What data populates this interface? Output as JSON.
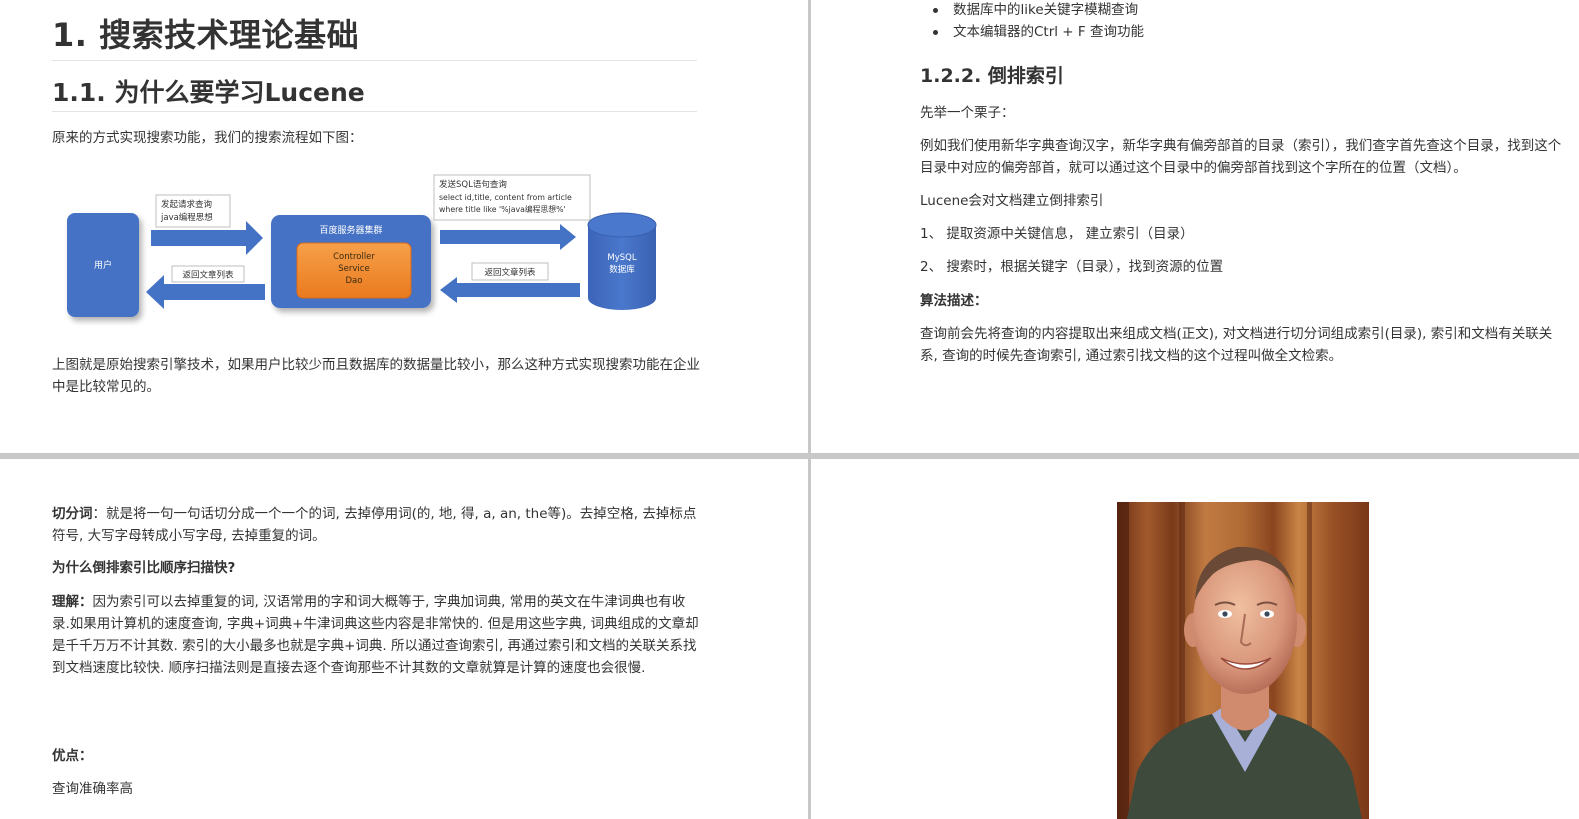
{
  "p1": {
    "h1": "1. 搜索技术理论基础",
    "h2": "1.1. 为什么要学习Lucene",
    "intro": "原来的方式实现搜索功能，我们的搜索流程如下图：",
    "diagram": {
      "user": "用户",
      "req_l1": "发起请求查询",
      "req_l2": "java编程思想",
      "ret1": "返回文章列表",
      "server_title": "百度服务器集群",
      "srv_l1": "Controller",
      "srv_l2": "Service",
      "srv_l3": "Dao",
      "sql_l1": "发送SQL语句查询",
      "sql_l2": "select id,title, content  from  article",
      "sql_l3": "where  title  like  '%java编程思想%'",
      "ret2": "返回文章列表",
      "db_l1": "MySQL",
      "db_l2": "数据库"
    },
    "outro": "上图就是原始搜索引擎技术，如果用户比较少而且数据库的数据量比较小，那么这种方式实现搜索功能在企业中是比较常见的。"
  },
  "p2": {
    "bullets": [
      "数据库中的like关键字模糊查询",
      "文本编辑器的Ctrl + F 查询功能"
    ],
    "h3": "1.2.2. 倒排索引",
    "p1": "先举一个栗子：",
    "p2": "例如我们使用新华字典查询汉字，新华字典有偏旁部首的目录（索引），我们查字首先查这个目录，找到这个目录中对应的偏旁部首，就可以通过这个目录中的偏旁部首找到这个字所在的位置（文档）。",
    "p3": "Lucene会对文档建立倒排索引",
    "p4": "1、 提取资源中关键信息， 建立索引（目录）",
    "p5": "2、 搜索时，根据关键字（目录），找到资源的位置",
    "algo_label": "算法描述：",
    "algo": "查询前会先将查询的内容提取出来组成文档(正文), 对文档进行切分词组成索引(目录), 索引和文档有关联关系, 查询的时候先查询索引, 通过索引找文档的这个过程叫做全文检索。"
  },
  "p3": {
    "seg_label": "切分词",
    "seg": "：就是将一句一句话切分成一个一个的词, 去掉停用词(的, 地, 得, a, an, the等)。去掉空格, 去掉标点符号, 大写字母转成小写字母, 去掉重复的词。",
    "why": "为什么倒排索引比顺序扫描快?",
    "under_label": "理解：",
    "under": "因为索引可以去掉重复的词, 汉语常用的字和词大概等于, 字典加词典, 常用的英文在牛津词典也有收录.如果用计算机的速度查询, 字典+词典+牛津词典这些内容是非常快的. 但是用这些字典, 词典组成的文章却是千千万万不计其数. 索引的大小最多也就是字典+词典. 所以通过查询索引, 再通过索引和文档的关联关系找到文档速度比较快. 顺序扫描法则是直接去逐个查询那些不计其数的文章就算是计算的速度也会很慢.",
    "adv_label": "优点：",
    "adv1": "查询准确率高"
  },
  "p4": {
    "photo": "portrait-photo"
  }
}
